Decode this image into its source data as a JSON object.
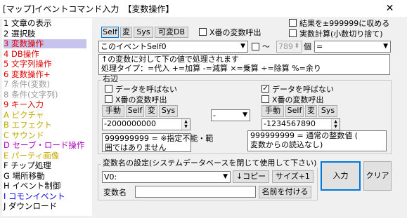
{
  "window": {
    "title": "[マップ]イベントコマンド入力　【変数操作】",
    "close": "✕"
  },
  "commands": [
    {
      "label": "1 文章の表示",
      "color": "#000000"
    },
    {
      "label": "2 選択肢",
      "color": "#000000"
    },
    {
      "label": "3 変数操作",
      "color": "#e00000"
    },
    {
      "label": "4 DB操作",
      "color": "#e00000"
    },
    {
      "label": "5 文字列操作",
      "color": "#e00000"
    },
    {
      "label": "6 変数操作+",
      "color": "#e00000"
    },
    {
      "label": "7 条件(変数)",
      "color": "#999999"
    },
    {
      "label": "8 条件(文字列)",
      "color": "#999999"
    },
    {
      "label": "9 キー入力",
      "color": "#e00000"
    },
    {
      "label": "A ピクチャ",
      "color": "#c5a800"
    },
    {
      "label": "B エフェクト",
      "color": "#c5a800"
    },
    {
      "label": "C サウンド",
      "color": "#c5a800"
    },
    {
      "label": "D セーブ・ロード操作",
      "color": "#b000c0"
    },
    {
      "label": "E パーティ画像",
      "color": "#c5a800"
    },
    {
      "label": "F チップ処理",
      "color": "#000000"
    },
    {
      "label": "G 場所移動",
      "color": "#000000"
    },
    {
      "label": "H イベント制御",
      "color": "#000000"
    },
    {
      "label": "I コモンイベント",
      "color": "#0000e0"
    },
    {
      "label": "J ダウンロード",
      "color": "#000000"
    }
  ],
  "selected_command": 2,
  "top_buttons": {
    "self": "Self",
    "hen": "変",
    "sys": "Sys",
    "kahen_db": "可変DB"
  },
  "x_call_top": "X番の変数呼出",
  "clamp_label": "結果を±999999に収める",
  "real_calc_label": "実数計算(小数切り捨て)",
  "target_combo": "このイベントSelf0",
  "tilde": "～",
  "count_value": "789",
  "count_unit": "個",
  "op_combo": "=",
  "info_text": "↑の変数に対して下の値で処理されます\n処理タイプ：=代入 +=加算 -=減算 ×=乗算 ÷=除算 %=余り",
  "right_side_label": "右辺",
  "left_operand": {
    "no_data_label": "データを呼ばない",
    "no_data_checked": false,
    "x_call_label": "X番の変数呼出",
    "x_call_checked": false,
    "buttons": {
      "manual": "手動",
      "self": "Self",
      "hen": "変",
      "sys": "Sys"
    },
    "value": "-2000000000",
    "note": "999999999 = ※指定不能・範\n囲ではありません"
  },
  "operator_combo": "-",
  "right_operand": {
    "no_data_label": "データを呼ばない",
    "no_data_checked": true,
    "x_call_label": "X番の変数呼出",
    "x_call_checked": false,
    "buttons": {
      "manual": "手動",
      "self": "Self",
      "hen": "変",
      "sys": "Sys"
    },
    "value": "-1234567890",
    "note": "999999999 = 通常の整数値 (\n変数からの読込なし)"
  },
  "varname_section": {
    "title": "変数名の設定(システムデータベースを閉じて使用して下さい)",
    "combo": "V0:",
    "copy_button": "↓コピー",
    "size_button": "サイズ+1",
    "name_label": "変数名",
    "name_value": "",
    "assign_button": "名前を付ける"
  },
  "input_button": "入力",
  "clear_button": "クリア"
}
